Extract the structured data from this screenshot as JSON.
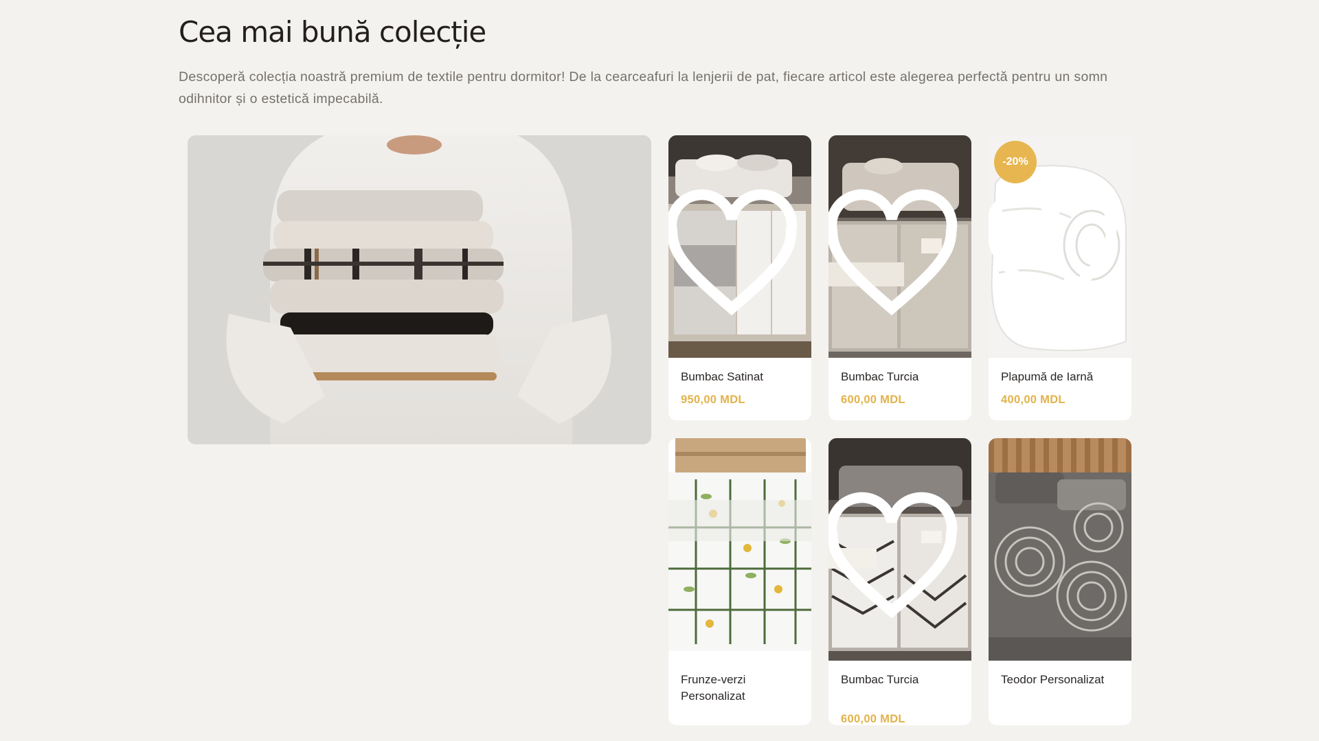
{
  "section": {
    "title": "Cea mai bună colecție",
    "description": "Descoperă colecția noastră premium de textile pentru dormitor! De la cearceafuri la lenjerii de pat, fiecare articol este alegerea perfectă pentru un somn odihnitor și o estetică impecabilă."
  },
  "colors": {
    "background": "#f3f2ef",
    "card": "#ffffff",
    "price": "#e2b24a",
    "badge": "#e8b650",
    "title": "#231f1d",
    "description": "#75716c"
  },
  "products": [
    {
      "name": "Bumbac Satinat",
      "price": "950,00 MDL",
      "favorite_icon": "heart-icon"
    },
    {
      "name": "Bumbac Turcia",
      "price": "600,00 MDL",
      "favorite_icon": "heart-icon"
    },
    {
      "name": "Plapumă de Iarnă",
      "price": "400,00 MDL",
      "badge": "-20%",
      "favorite_icon": "heart-icon"
    },
    {
      "name": "Frunze-verzi Personalizat",
      "price": ""
    },
    {
      "name": "Bumbac Turcia",
      "price": "600,00 MDL",
      "favorite_icon": "heart-icon"
    },
    {
      "name": "Teodor Personalizat",
      "price": ""
    }
  ]
}
